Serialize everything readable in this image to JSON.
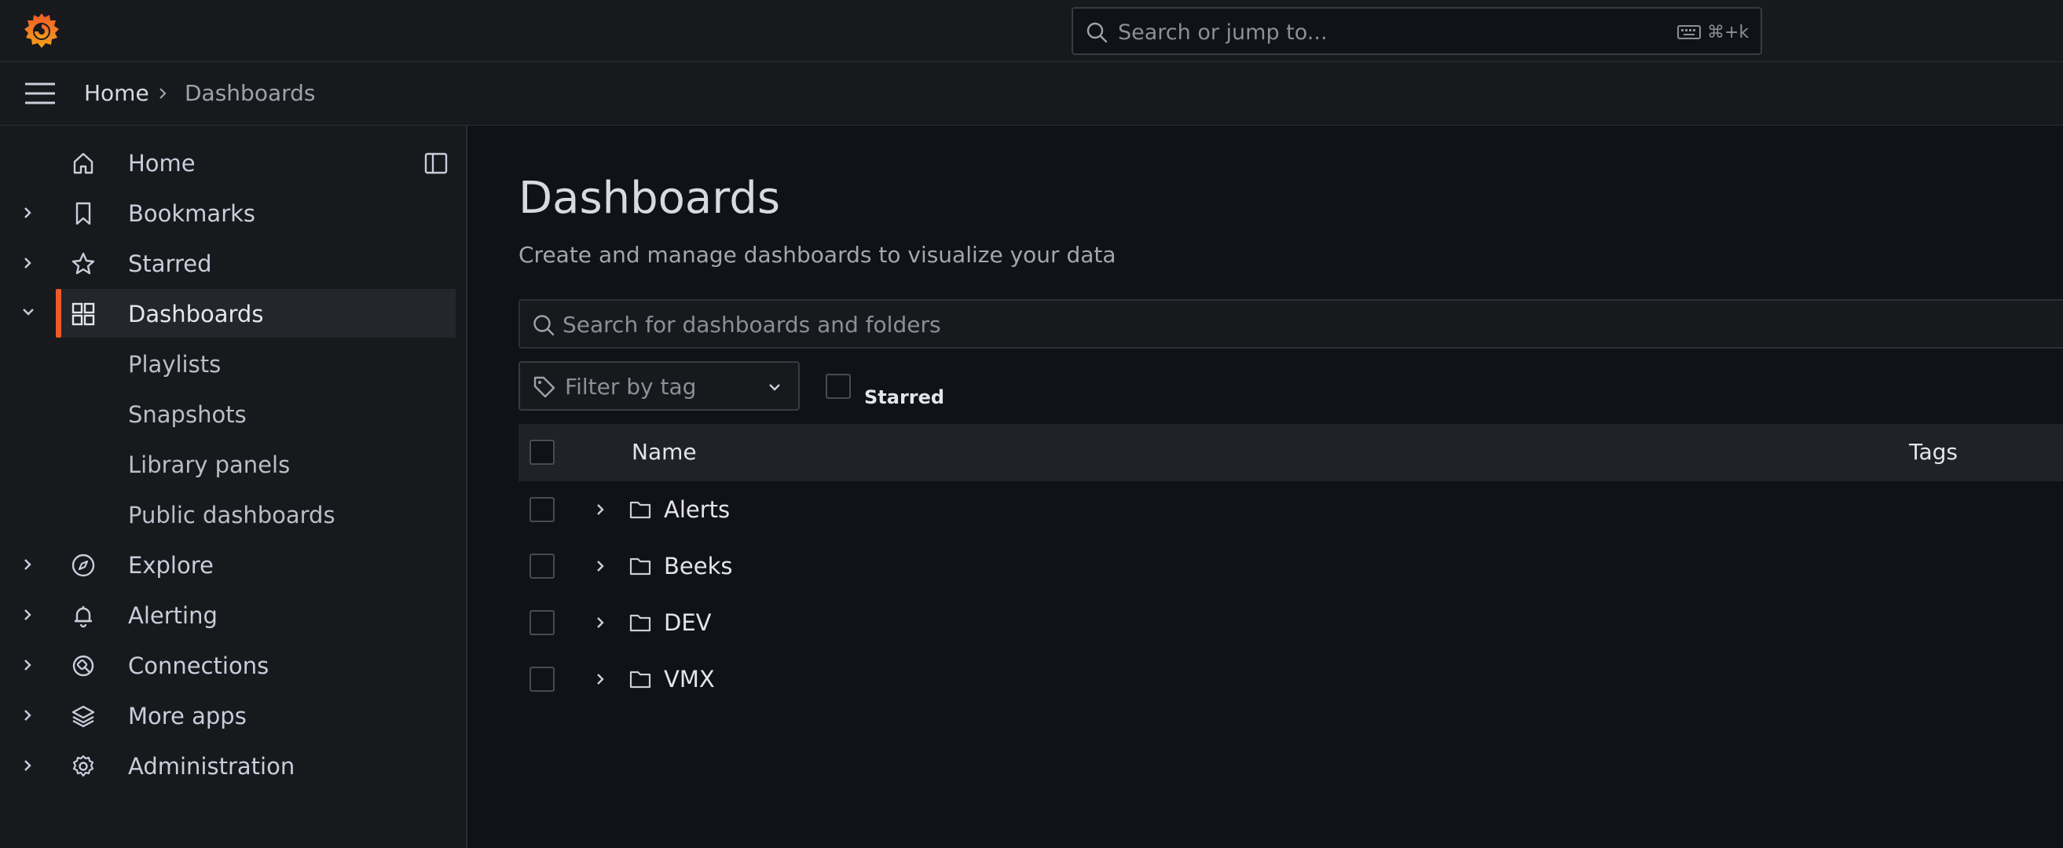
{
  "topbar": {
    "logo": "grafana-logo",
    "search_placeholder": "Search or jump to...",
    "shortcut": "⌘+k"
  },
  "breadcrumb": {
    "home": "Home",
    "current": "Dashboards"
  },
  "sidebar": {
    "items": [
      {
        "label": "Home",
        "icon": "home-icon"
      },
      {
        "label": "Bookmarks",
        "icon": "bookmark-icon"
      },
      {
        "label": "Starred",
        "icon": "star-icon"
      },
      {
        "label": "Dashboards",
        "icon": "apps-icon",
        "active": true
      },
      {
        "label": "Playlists"
      },
      {
        "label": "Snapshots"
      },
      {
        "label": "Library panels"
      },
      {
        "label": "Public dashboards"
      },
      {
        "label": "Explore",
        "icon": "compass-icon"
      },
      {
        "label": "Alerting",
        "icon": "bell-icon"
      },
      {
        "label": "Connections",
        "icon": "connections-icon"
      },
      {
        "label": "More apps",
        "icon": "layers-icon"
      },
      {
        "label": "Administration",
        "icon": "cog-icon"
      }
    ]
  },
  "main": {
    "title": "Dashboards",
    "subtitle": "Create and manage dashboards to visualize your data",
    "search_placeholder": "Search for dashboards and folders",
    "tag_filter_placeholder": "Filter by tag",
    "starred_label": "Starred",
    "table": {
      "columns": [
        "Name",
        "Tags"
      ],
      "rows": [
        {
          "name": "Alerts"
        },
        {
          "name": "Beeks"
        },
        {
          "name": "DEV"
        },
        {
          "name": "VMX"
        }
      ]
    }
  },
  "colors": {
    "accent": "#f05a28",
    "background": "#111217",
    "panel": "#18191d"
  }
}
